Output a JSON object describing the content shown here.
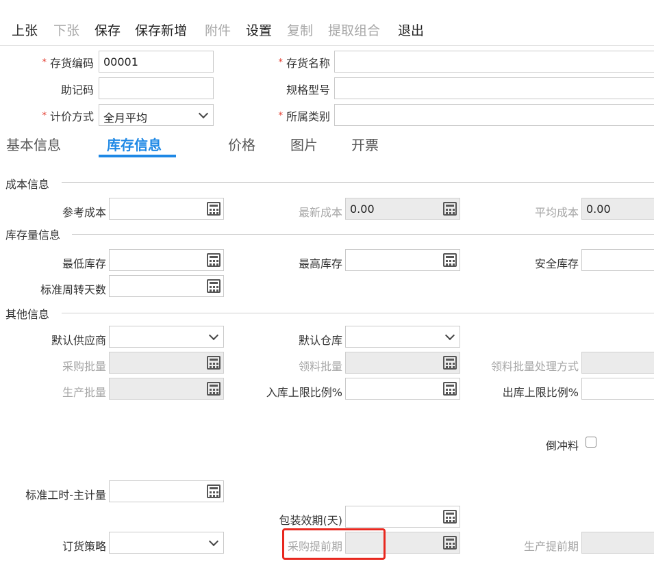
{
  "toolbar": {
    "items": [
      {
        "label": "上张",
        "enabled": true
      },
      {
        "label": "下张",
        "enabled": false
      },
      {
        "label": "保存",
        "enabled": true
      },
      {
        "label": "保存新增",
        "enabled": true
      },
      {
        "label": "附件",
        "enabled": false
      },
      {
        "label": "设置",
        "enabled": true
      },
      {
        "label": "复制",
        "enabled": false
      },
      {
        "label": "提取组合",
        "enabled": false
      },
      {
        "label": "退出",
        "enabled": true
      }
    ]
  },
  "header": {
    "code_label": "存货编码",
    "code_value": "00001",
    "name_label": "存货名称",
    "name_value": "",
    "mnemonic_label": "助记码",
    "mnemonic_value": "",
    "spec_label": "规格型号",
    "spec_value": "",
    "pricing_label": "计价方式",
    "pricing_value": "全月平均",
    "category_label": "所属类别",
    "category_value": "",
    "required_mark": "*"
  },
  "tabs": [
    {
      "label": "基本信息",
      "active": false
    },
    {
      "label": "库存信息",
      "active": true
    },
    {
      "label": "价格",
      "active": false
    },
    {
      "label": "图片",
      "active": false
    },
    {
      "label": "开票",
      "active": false
    }
  ],
  "sections": {
    "cost": "成本信息",
    "stock": "库存量信息",
    "other": "其他信息"
  },
  "fields": {
    "ref_cost": {
      "label": "参考成本",
      "value": ""
    },
    "latest_cost": {
      "label": "最新成本",
      "value": "0.00"
    },
    "avg_cost": {
      "label": "平均成本",
      "value": "0.00"
    },
    "min_stock": {
      "label": "最低库存",
      "value": ""
    },
    "max_stock": {
      "label": "最高库存",
      "value": ""
    },
    "safe_stock": {
      "label": "安全库存",
      "value": ""
    },
    "turnover_days": {
      "label": "标准周转天数",
      "value": ""
    },
    "default_supplier": {
      "label": "默认供应商",
      "value": ""
    },
    "default_warehouse": {
      "label": "默认仓库",
      "value": ""
    },
    "purchase_batch": {
      "label": "采购批量",
      "value": ""
    },
    "pick_batch": {
      "label": "领料批量",
      "value": ""
    },
    "pick_batch_mode": {
      "label": "领料批量处理方式",
      "value": ""
    },
    "production_batch": {
      "label": "生产批量",
      "value": ""
    },
    "inbound_ratio": {
      "label": "入库上限比例%",
      "value": ""
    },
    "outbound_ratio": {
      "label": "出库上限比例%",
      "value": ""
    },
    "backflush": {
      "label": "倒冲料",
      "checked": false
    },
    "std_hours": {
      "label": "标准工时-主计量",
      "value": ""
    },
    "shelf_life": {
      "label": "包装效期(天)",
      "value": ""
    },
    "order_policy": {
      "label": "订货策略",
      "value": ""
    },
    "purchase_lead": {
      "label": "采购提前期",
      "value": ""
    },
    "production_lead": {
      "label": "生产提前期",
      "value": ""
    }
  },
  "highlight_color": "#e8281f",
  "accent_color": "#1e88e5"
}
